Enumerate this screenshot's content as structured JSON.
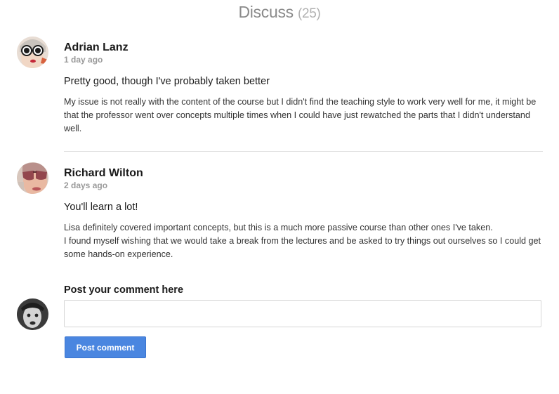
{
  "header": {
    "title": "Discuss",
    "count": "(25)"
  },
  "comments": [
    {
      "author": "Adrian Lanz",
      "time": "1 day ago",
      "headline": "Pretty good, though I've probably taken better",
      "text": "My issue is not really with the content of the course but I didn't find the teaching style to work very well for me, it might be that the professor went over concepts multiple times when I could have just rewatched the parts that I didn't understand well.",
      "avatar_icon": "user-avatar-sunglasses-icon"
    },
    {
      "author": "Richard Wilton",
      "time": "2 days ago",
      "headline": "You'll learn a lot!",
      "text_lines": [
        "Lisa definitely covered important concepts, but this is a much more passive course than other ones I've taken.",
        "I found myself wishing that we would take a break from the lectures and be asked to try things out ourselves so I could get some hands-on experience."
      ],
      "avatar_icon": "user-avatar-aviator-icon"
    }
  ],
  "compose": {
    "label": "Post your comment here",
    "input_value": "",
    "input_placeholder": "",
    "button_label": "Post comment",
    "avatar_icon": "current-user-avatar-icon"
  },
  "colors": {
    "accent": "#4a86e0",
    "title": "#8a8a8a",
    "muted": "#9a9a9a",
    "divider": "#dddddd"
  }
}
